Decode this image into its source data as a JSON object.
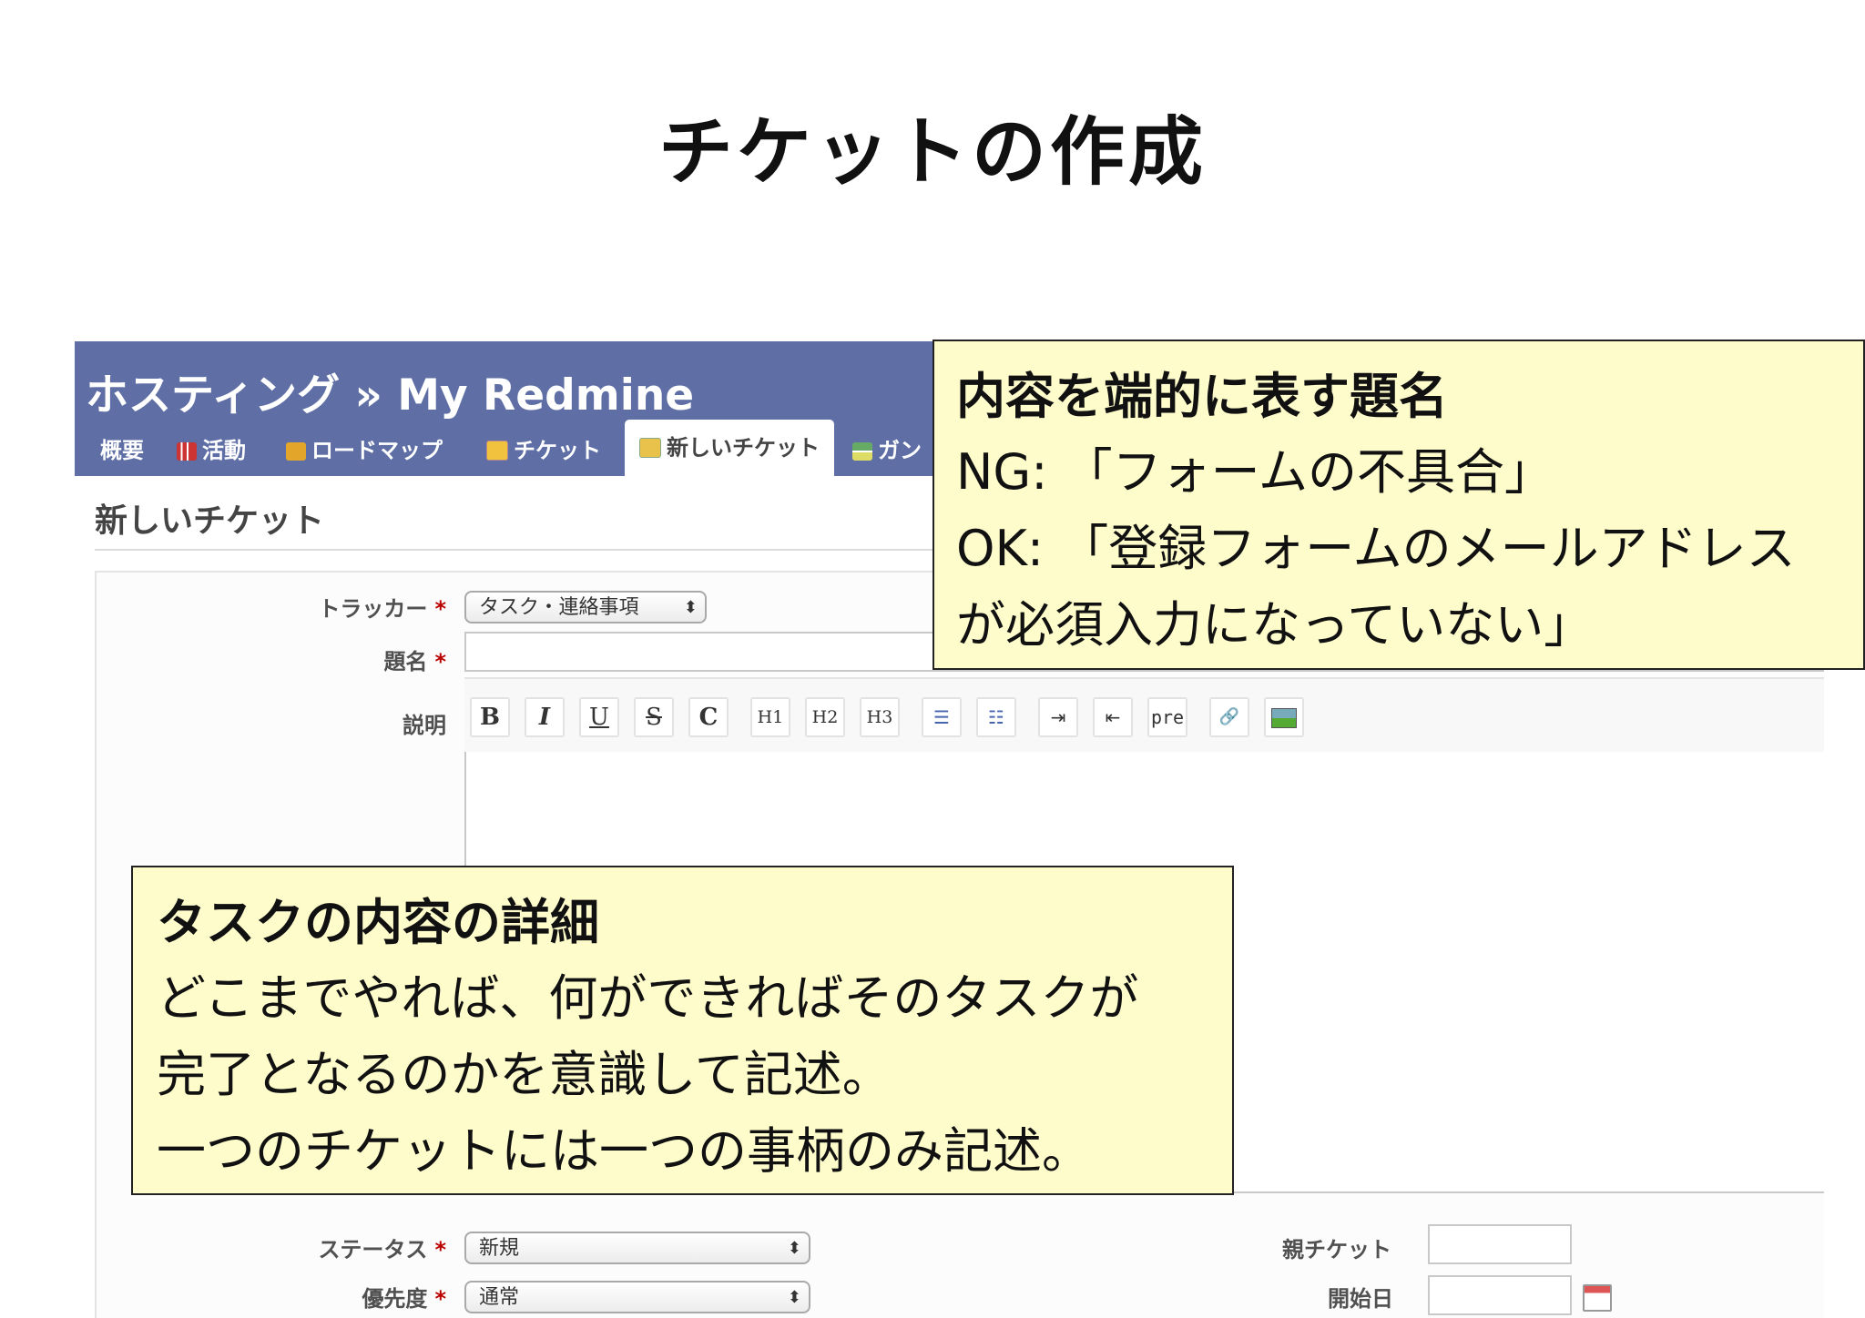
{
  "slide": {
    "title": "チケットの作成"
  },
  "redmine": {
    "project_title": "ホスティング » My Redmine",
    "tabs": [
      {
        "label": "概要"
      },
      {
        "label": "活動",
        "icon": "activity-icon"
      },
      {
        "label": "ロードマップ",
        "icon": "roadmap-icon"
      },
      {
        "label": "チケット",
        "icon": "ticket-icon"
      },
      {
        "label": "新しいチケット",
        "icon": "new-ticket-icon",
        "selected": true
      },
      {
        "label": "ガン",
        "icon": "gantt-icon"
      }
    ],
    "page_heading": "新しいチケット",
    "form": {
      "tracker_label": "トラッカー",
      "tracker_value": "タスク・連絡事項",
      "subject_label": "題名",
      "description_label": "説明",
      "required_mark": "*",
      "toolbar": [
        "B",
        "I",
        "U",
        "S",
        "C",
        "H1",
        "H2",
        "H3",
        "ul",
        "ol",
        "indent",
        "outdent",
        "pre",
        "link",
        "image"
      ],
      "toolbar_pre_label": "pre",
      "status_label": "ステータス",
      "status_value": "新規",
      "priority_label": "優先度",
      "priority_value": "通常",
      "parent_label": "親チケット",
      "start_date_label": "開始日",
      "select_arrows": "⬍"
    }
  },
  "callouts": {
    "subject": {
      "title": "内容を端的に表す題名",
      "lines": [
        "NG: 「フォームの不具合」",
        "OK: 「登録フォームのメールアドレス",
        "が必須入力になっていない」"
      ]
    },
    "description": {
      "title": "タスクの内容の詳細",
      "lines": [
        "どこまでやれば、何ができればそのタスクが",
        "完了となるのかを意識して記述。",
        "一つのチケットには一つの事柄のみ記述。"
      ]
    }
  }
}
